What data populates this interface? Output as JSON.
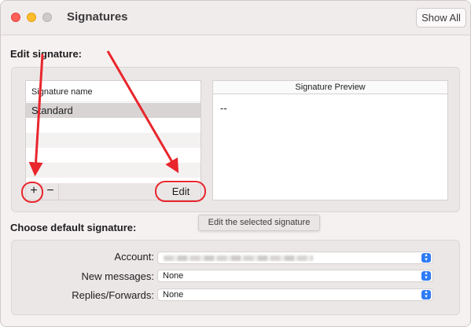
{
  "window": {
    "title": "Signatures",
    "show_all_label": "Show All"
  },
  "edit_section": {
    "heading": "Edit signature:",
    "list_header": "Signature name",
    "signatures": [
      "Standard"
    ],
    "add_label": "+",
    "remove_label": "−",
    "edit_label": "Edit",
    "preview_header": "Signature Preview",
    "preview_text": "--",
    "tooltip": "Edit the selected signature"
  },
  "default_section": {
    "heading": "Choose default signature:",
    "account_label": "Account:",
    "account_value": "",
    "new_messages_label": "New messages:",
    "new_messages_value": "None",
    "replies_label": "Replies/Forwards:",
    "replies_value": "None"
  },
  "colors": {
    "annotation": "#e8262c",
    "stepper": "#2f7bf6"
  },
  "icons": {
    "stepper": "chevron-up-down-icon",
    "add": "plus-icon",
    "remove": "minus-icon"
  }
}
